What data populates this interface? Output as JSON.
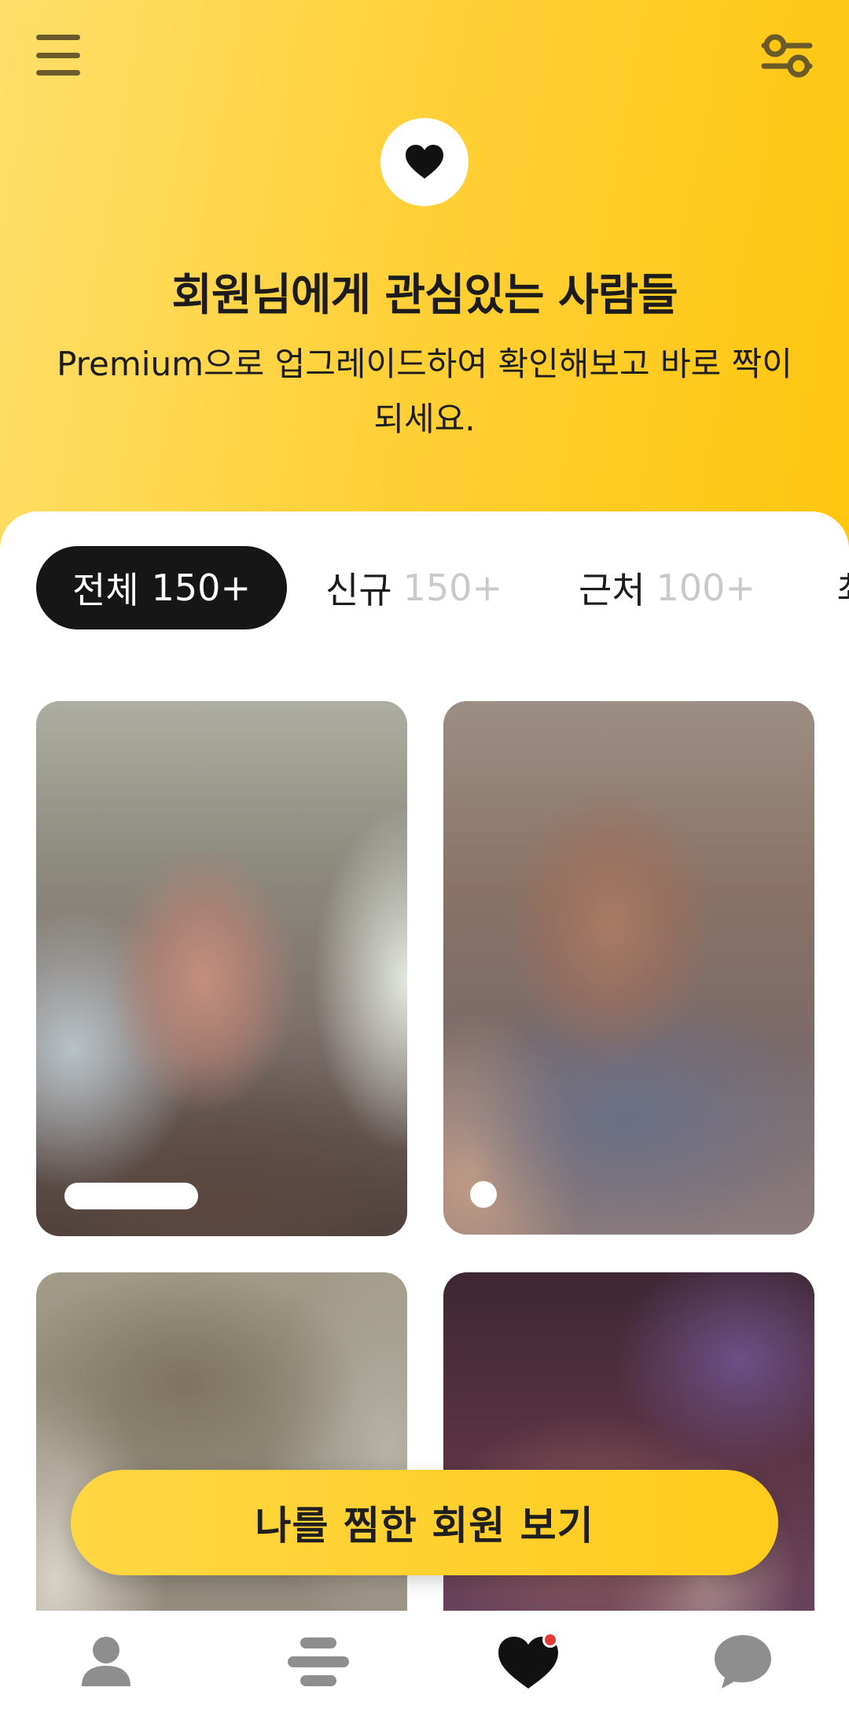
{
  "header": {
    "title": "회원님에게 관심있는 사람들",
    "subtitle": "Premium으로 업그레이드하여 확인해보고 바로 짝이 되세요."
  },
  "tabs": [
    {
      "label": "전체",
      "count": "150+",
      "active": true
    },
    {
      "label": "신규",
      "count": "150+",
      "active": false
    },
    {
      "label": "근처",
      "count": "100+",
      "active": false
    },
    {
      "label": "최",
      "count": "",
      "active": false
    }
  ],
  "cards": [
    {
      "badge": "pill"
    },
    {
      "badge": "dot"
    },
    {
      "badge": "none"
    },
    {
      "badge": "none"
    }
  ],
  "cta": {
    "label": "나를 찜한 회원 보기"
  },
  "bottom_nav": {
    "items": [
      "profile-icon",
      "discover-icon",
      "liked-you-icon",
      "chat-icon"
    ],
    "active_index": 2,
    "notification_dot": true
  },
  "colors": {
    "accent": "#ffc60e",
    "accent_light": "#ffdf6b",
    "dark": "#161616",
    "notification": "#e53935",
    "nav_inactive": "#8e8e8e"
  }
}
